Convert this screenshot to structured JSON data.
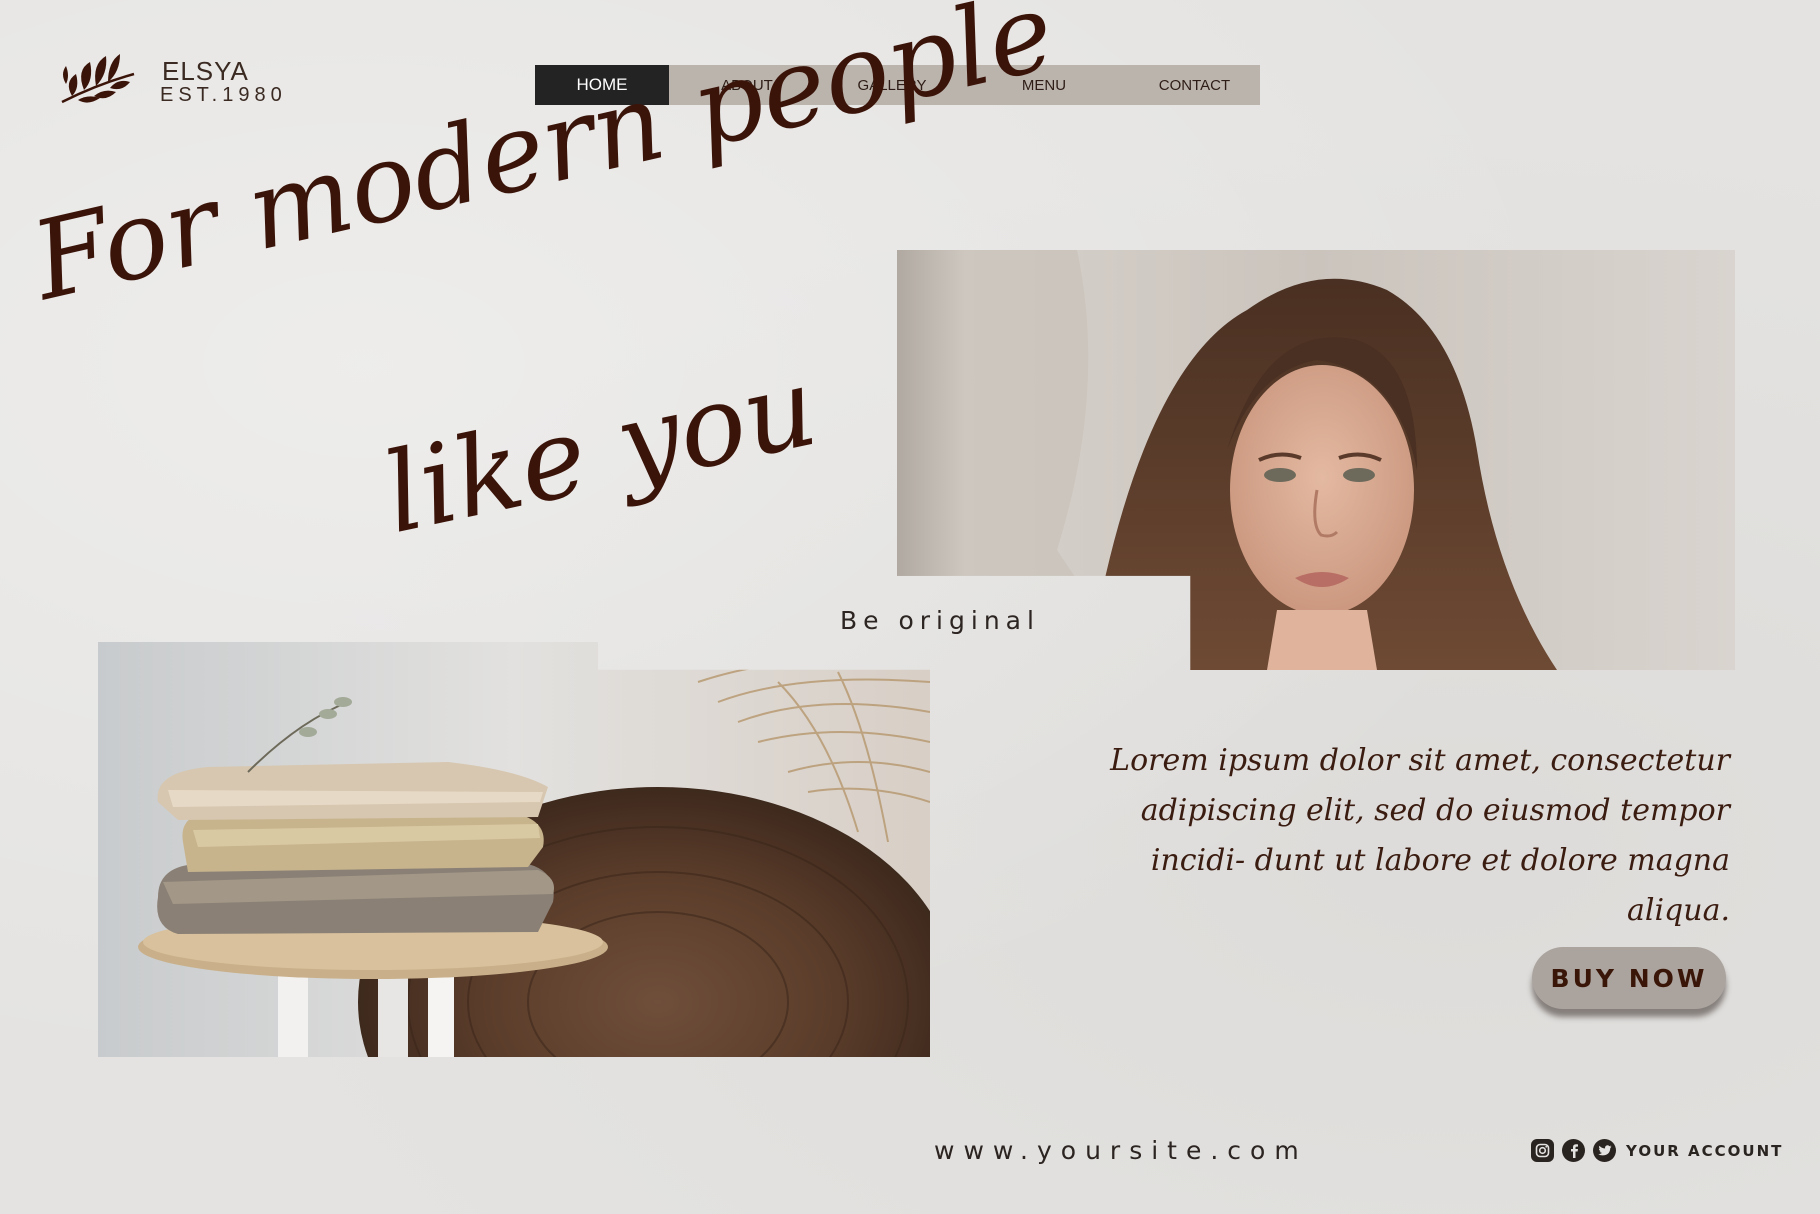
{
  "brand": {
    "name": "ELSYA",
    "est": "EST.1980",
    "logo_icon": "leaf-branch-icon"
  },
  "nav": {
    "items": [
      {
        "label": "HOME",
        "active": true
      },
      {
        "label": "ABOUT",
        "active": false
      },
      {
        "label": "GALLERY",
        "active": false
      },
      {
        "label": "MENU",
        "active": false
      },
      {
        "label": "CONTACT",
        "active": false
      }
    ]
  },
  "hero": {
    "headline_line1": "For modern people",
    "headline_line2": "like you",
    "tagline": "Be original",
    "body": "Lorem ipsum dolor sit amet, consectetur adipiscing elit, sed do eiusmod tempor incidi- dunt ut labore et dolore magna aliqua.",
    "cta": "BUY NOW"
  },
  "footer": {
    "website": "www.yoursite.com",
    "social_icons": [
      "instagram-icon",
      "facebook-icon",
      "twitter-icon"
    ],
    "account": "YOUR ACCOUNT"
  },
  "colors": {
    "background": "#e4e3e1",
    "accent_brown": "#3b1409",
    "nav_bg": "#bbb4ad",
    "nav_active": "#232323",
    "button_bg": "#aba49e"
  }
}
